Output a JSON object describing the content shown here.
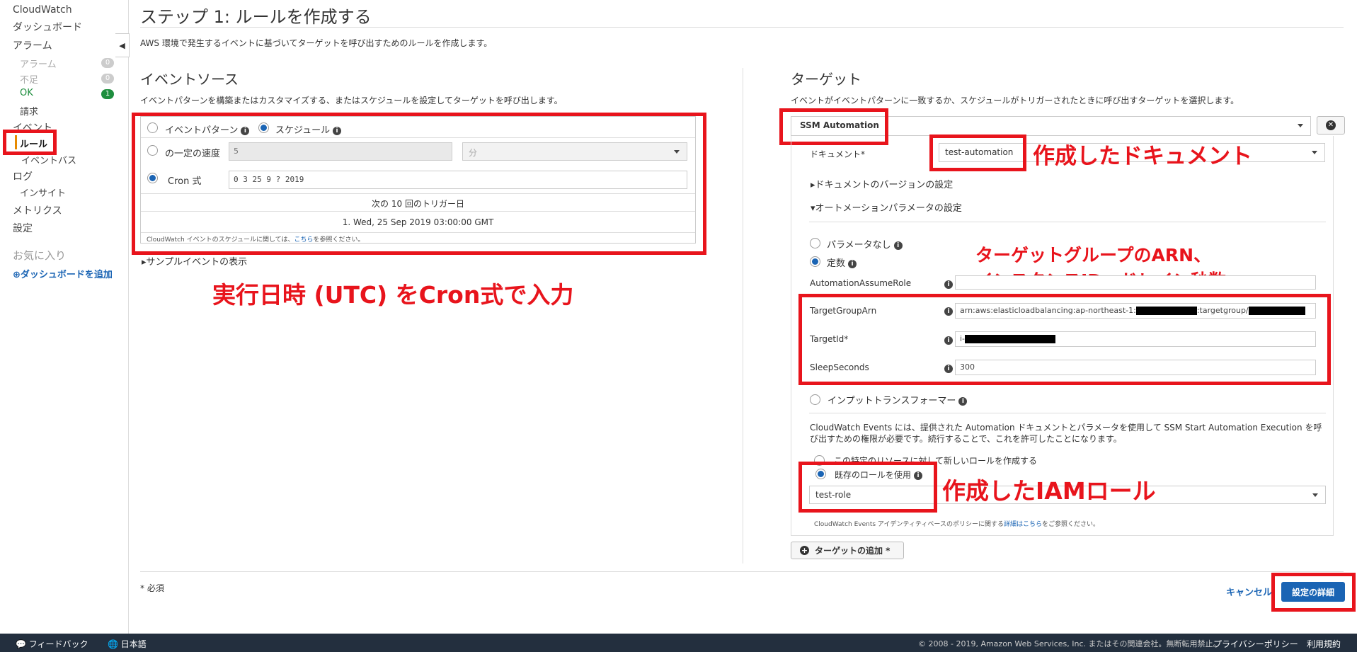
{
  "sidebar": {
    "cloudwatch": "CloudWatch",
    "dashboard": "ダッシュボード",
    "alarm": "アラーム",
    "alarm_sub": {
      "label": "アラーム",
      "count": "0"
    },
    "insufficient": {
      "label": "不足",
      "count": "0"
    },
    "ok": {
      "label": "OK",
      "count": "1"
    },
    "billing": "請求",
    "events": "イベント",
    "rules": "ルール",
    "eventbus": "イベントバス",
    "logs": "ログ",
    "insights": "インサイト",
    "metrics": "メトリクス",
    "settings": "設定",
    "favorites": "お気に入り",
    "add_dashboard": "ダッシュボードを追加"
  },
  "header": {
    "title": "ステップ 1: ルールを作成する",
    "description": "AWS 環境で発生するイベントに基づいてターゲットを呼び出すためのルールを作成します。"
  },
  "event_source": {
    "title": "イベントソース",
    "description": "イベントパターンを構築またはカスタマイズする、またはスケジュールを設定してターゲットを呼び出します。",
    "event_pattern_label": "イベントパターン",
    "schedule_label": "スケジュール",
    "fixed_rate_label": "の一定の速度",
    "fixed_rate_value": "5",
    "unit_value": "分",
    "cron_label": "Cron 式",
    "cron_value": "0 3 25 9 ? 2019",
    "next_triggers_label": "次の 10 回のトリガー日",
    "next_trigger_1": "1. Wed, 25 Sep 2019 03:00:00 GMT",
    "note_prefix": "CloudWatch イベントのスケジュールに関しては、",
    "note_link": "こちら",
    "note_suffix": "を参照ください。",
    "sample_event": "サンプルイベントの表示"
  },
  "target": {
    "title": "ターゲット",
    "description": "イベントがイベントパターンに一致するか、スケジュールがトリガーされたときに呼び出すターゲットを選択します。",
    "selected": "SSM Automation",
    "document_label": "ドキュメント*",
    "document_value": "test-automation",
    "doc_version": "ドキュメントのバージョンの設定",
    "automation_params": "オートメーションパラメータの設定",
    "no_params": "パラメータなし",
    "constant": "定数",
    "param_assume_role": "AutomationAssumeRole",
    "param_target_group": "TargetGroupArn",
    "param_target_group_value_a": "arn:aws:elasticloadbalancing:ap-northeast-1:",
    "param_target_group_value_b": ":targetgroup/",
    "param_target_id": "TargetId*",
    "param_target_id_value": "i-",
    "param_sleep": "SleepSeconds",
    "param_sleep_value": "300",
    "input_transformer": "インプットトランスフォーマー",
    "permission_text": "CloudWatch Events には、提供された Automation ドキュメントとパラメータを使用して SSM Start Automation Execution を呼び出すための権限が必要です。続行することで、これを許可したことになります。",
    "new_role": "この特定のリソースに対して新しいロールを作成する",
    "existing_role": "既存のロールを使用",
    "role_value": "test-role",
    "policy_note_prefix": "CloudWatch Events アイデンティティベースのポリシーに関する",
    "policy_note_link": "詳細はこちら",
    "policy_note_suffix": "をご参照ください。",
    "add_target": "ターゲットの追加 *"
  },
  "annotations": {
    "document_created": "作成したドキュメント",
    "cron_input": "実行日時 (UTC) をCron式で入力",
    "params_line1": "ターゲットグループのARN、",
    "params_line2": "インスタンスID、ドレイン秒数",
    "iam_created": "作成したIAMロール",
    "color": "#e8141c"
  },
  "footer_bar": {
    "required": "* 必須",
    "cancel": "キャンセル",
    "next": "設定の詳細"
  },
  "footer": {
    "feedback": "フィードバック",
    "language": "日本語",
    "copyright": "© 2008 - 2019, Amazon Web Services, Inc. またはその関連会社。無断転用禁止。",
    "privacy": "プライバシーポリシー",
    "terms": "利用規約"
  }
}
